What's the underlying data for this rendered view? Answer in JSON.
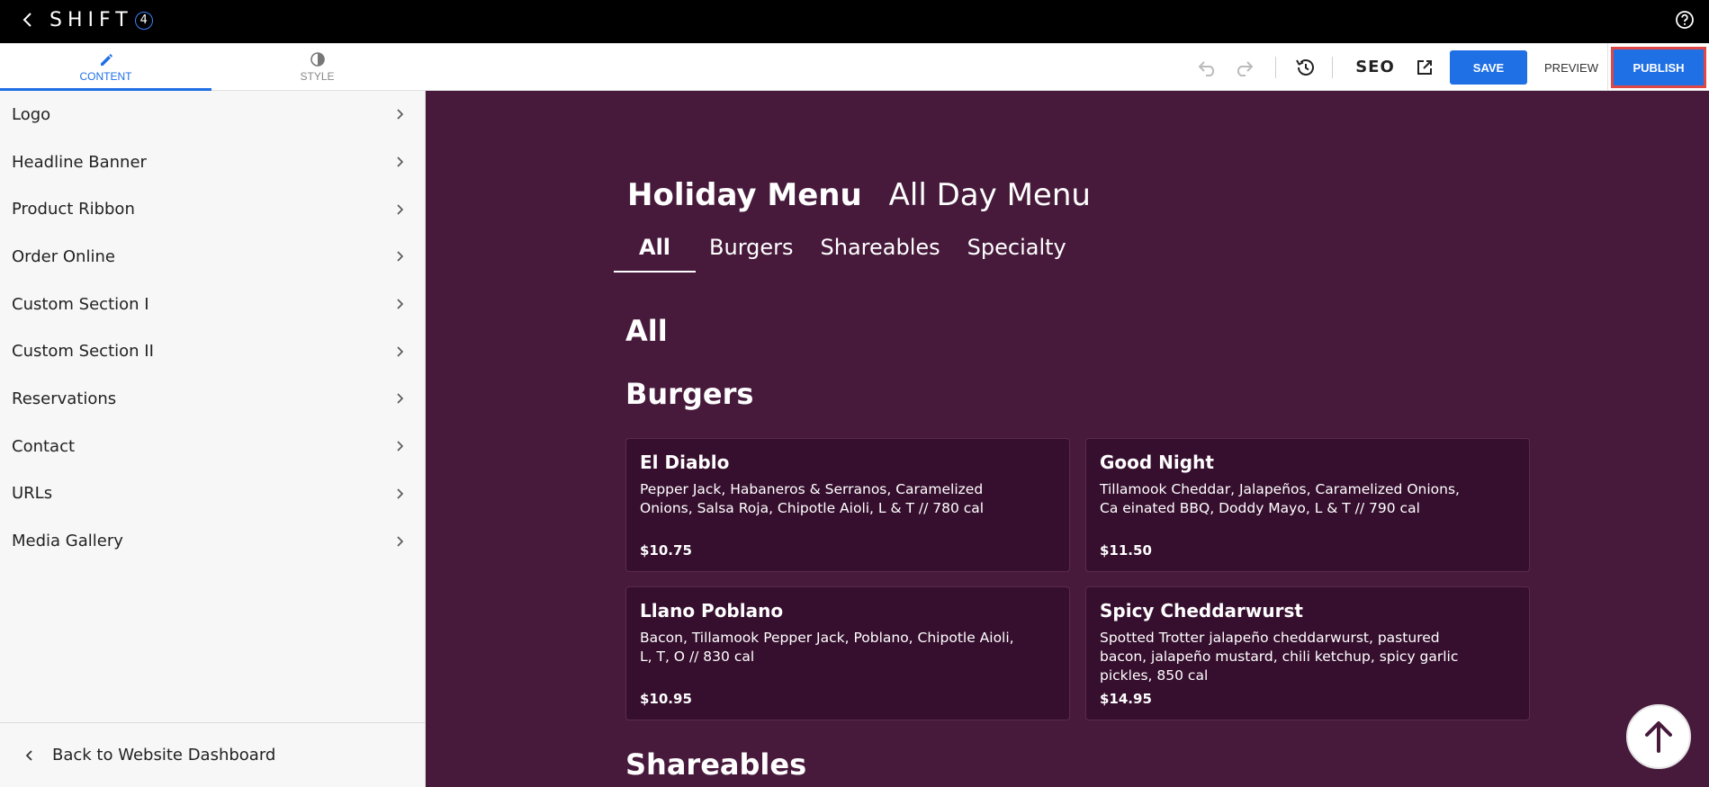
{
  "topbar": {
    "brand": "SHIFT",
    "brand_mark": "4"
  },
  "sidebar_tabs": [
    {
      "label": "CONTENT"
    },
    {
      "label": "STYLE"
    }
  ],
  "toolbar": {
    "seo_label": "SEO",
    "save_label": "SAVE",
    "preview_label": "PREVIEW",
    "publish_label": "PUBLISH"
  },
  "sidebar": {
    "items": [
      {
        "label": "Logo"
      },
      {
        "label": "Headline Banner"
      },
      {
        "label": "Product Ribbon"
      },
      {
        "label": "Order Online"
      },
      {
        "label": "Custom Section I"
      },
      {
        "label": "Custom Section II"
      },
      {
        "label": "Reservations"
      },
      {
        "label": "Contact"
      },
      {
        "label": "URLs"
      },
      {
        "label": "Media Gallery"
      }
    ],
    "back_label": "Back to Website Dashboard"
  },
  "preview": {
    "menus": [
      {
        "label": "Holiday Menu"
      },
      {
        "label": "All Day Menu"
      }
    ],
    "categories": [
      {
        "label": "All"
      },
      {
        "label": "Burgers"
      },
      {
        "label": "Shareables"
      },
      {
        "label": "Specialty"
      }
    ],
    "heading_all": "All",
    "heading_burgers": "Burgers",
    "heading_shareables": "Shareables",
    "items": [
      {
        "name": "El Diablo",
        "description": "Pepper Jack, Habaneros & Serranos, Caramelized Onions, Salsa Roja, Chipotle Aioli, L & T // 780 cal",
        "price": "$10.75"
      },
      {
        "name": "Good Night",
        "description": "Tillamook Cheddar, Jalapeños, Caramelized Onions, Ca einated BBQ, Doddy Mayo, L & T // 790 cal",
        "price": "$11.50"
      },
      {
        "name": "Llano Poblano",
        "description": "Bacon, Tillamook Pepper Jack, Poblano, Chipotle Aioli, L, T, O // 830 cal",
        "price": "$10.95"
      },
      {
        "name": "Spicy Cheddarwurst",
        "description": "Spotted Trotter jalapeño cheddarwurst, pastured bacon, jalapeño mustard, chili ketchup, spicy garlic pickles, 850 cal",
        "price": "$14.95"
      }
    ]
  },
  "colors": {
    "accent": "#1f6fe5",
    "preview_bg": "#471a3c",
    "card_bg": "#360f2e",
    "publish_outline": "#e04848"
  }
}
